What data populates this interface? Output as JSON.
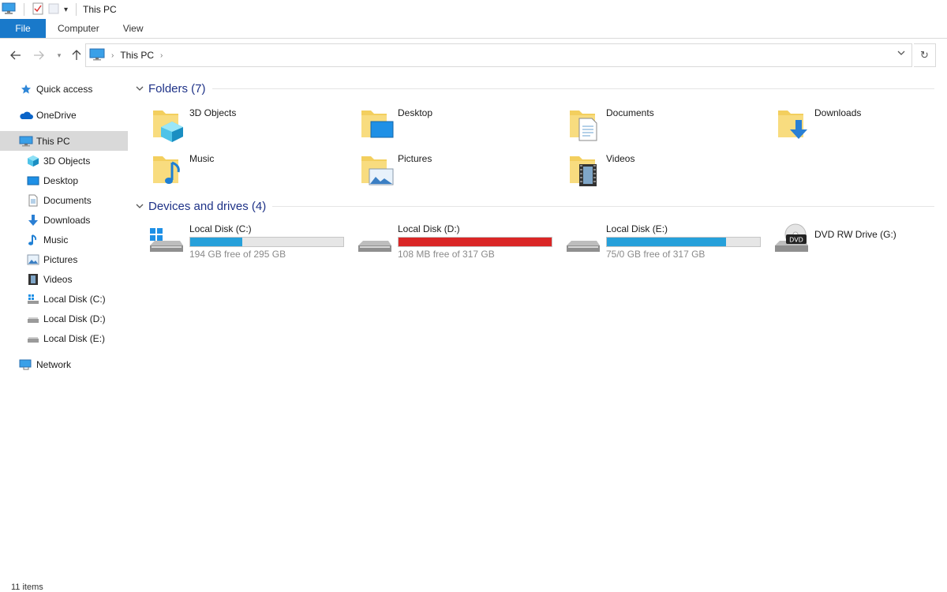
{
  "window": {
    "title": "This PC"
  },
  "ribbon": {
    "tabs": [
      "File",
      "Computer",
      "View"
    ]
  },
  "address": {
    "crumbs": [
      "This PC"
    ]
  },
  "sidebar": {
    "items": [
      {
        "label": "Quick access",
        "icon": "star-icon"
      },
      {
        "label": "OneDrive",
        "icon": "cloud-icon"
      },
      {
        "label": "This PC",
        "icon": "computer-icon",
        "selected": true
      },
      {
        "label": "3D Objects",
        "icon": "cube-icon"
      },
      {
        "label": "Desktop",
        "icon": "desktop-icon"
      },
      {
        "label": "Documents",
        "icon": "document-icon"
      },
      {
        "label": "Downloads",
        "icon": "download-arrow-icon"
      },
      {
        "label": "Music",
        "icon": "music-note-icon"
      },
      {
        "label": "Pictures",
        "icon": "picture-icon"
      },
      {
        "label": "Videos",
        "icon": "film-icon"
      },
      {
        "label": "Local Disk (C:)",
        "icon": "windows-drive-icon"
      },
      {
        "label": "Local Disk (D:)",
        "icon": "drive-icon"
      },
      {
        "label": "Local Disk (E:)",
        "icon": "drive-icon"
      },
      {
        "label": "Network",
        "icon": "network-icon"
      }
    ]
  },
  "folders": {
    "heading": "Folders (7)",
    "items": [
      {
        "label": "3D Objects",
        "icon": "cube-icon"
      },
      {
        "label": "Desktop",
        "icon": "desktop-icon"
      },
      {
        "label": "Documents",
        "icon": "document-icon"
      },
      {
        "label": "Downloads",
        "icon": "download-arrow-icon"
      },
      {
        "label": "Music",
        "icon": "music-note-icon"
      },
      {
        "label": "Pictures",
        "icon": "picture-icon"
      },
      {
        "label": "Videos",
        "icon": "film-icon"
      }
    ]
  },
  "devices": {
    "heading": "Devices and drives (4)",
    "items": [
      {
        "label": "Local Disk (C:)",
        "free_text": "194 GB free of 295 GB",
        "used_fraction": 0.34,
        "bar_color": "#26a0da",
        "icon": "windows-drive-icon"
      },
      {
        "label": "Local Disk (D:)",
        "free_text": "108 MB free of 317 GB",
        "used_fraction": 1.0,
        "bar_color": "#da2626",
        "icon": "drive-icon"
      },
      {
        "label": "Local Disk (E:)",
        "free_text": "75/0 GB free of 317 GB",
        "used_fraction": 0.78,
        "bar_color": "#26a0da",
        "icon": "drive-icon"
      },
      {
        "label": "DVD RW Drive (G:)",
        "icon": "dvd-drive-icon"
      }
    ]
  },
  "status": {
    "text": "11 items"
  },
  "colors": {
    "accent": "#1979ca",
    "heading": "#1e3287",
    "folder": "#f3cf5e",
    "selection": "#d9d9d9"
  }
}
